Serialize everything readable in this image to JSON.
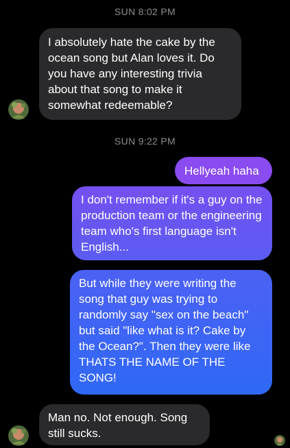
{
  "thread": {
    "timestamps": [
      "SUN 8:02 PM",
      "SUN 9:22 PM"
    ],
    "messages": [
      {
        "from": "them",
        "text": "I absolutely hate the cake by the ocean song but Alan loves it. Do you have any interesting trivia about that song to make it somewhat redeemable?"
      },
      {
        "from": "me",
        "text": "Hellyeah haha"
      },
      {
        "from": "me",
        "text": "I don't remember if it's a guy on the production team or the engineering team who's first language isn't English..."
      },
      {
        "from": "me",
        "text": "But while they were writing the song that guy was trying to randomly say \"sex on the beach\" but said \"like what is it? Cake by the Ocean?\". Then they were like THATS THE NAME OF THE SONG!"
      },
      {
        "from": "them",
        "text": "Man no. Not enough. Song still sucks."
      }
    ]
  },
  "colors": {
    "background": "#000000",
    "incoming_bubble": "#2a2a2c",
    "outgoing_top": "#8a4bf0",
    "outgoing_bottom": "#2f68f6",
    "timestamp": "#8e8e93"
  },
  "icons": [
    "avatar",
    "read-receipt-avatar"
  ]
}
